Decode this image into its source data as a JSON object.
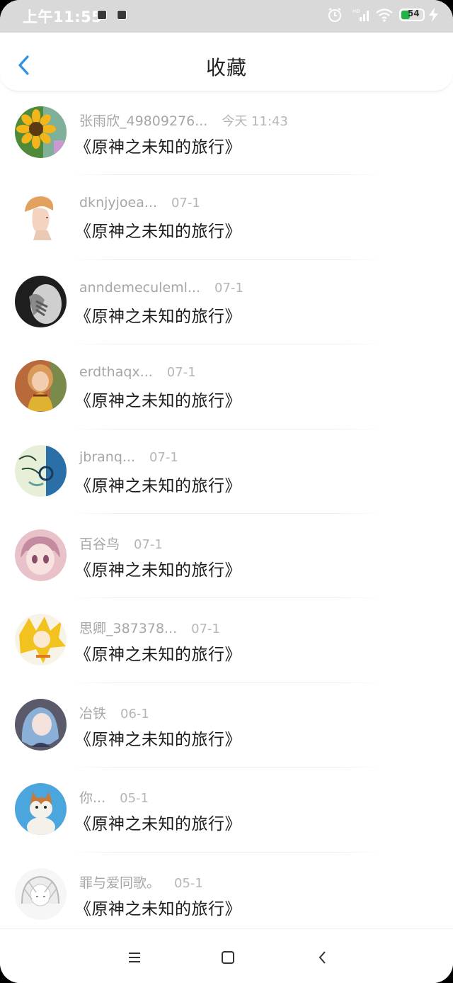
{
  "status_bar": {
    "time": "上午11:55",
    "battery_level": "54",
    "icons": [
      "alarm-icon",
      "signal-icon",
      "wifi-icon",
      "battery-icon",
      "charging-icon"
    ]
  },
  "header": {
    "title": "收藏",
    "back_icon": "chevron-left-icon"
  },
  "items": [
    {
      "name": "张雨欣_49809276...",
      "date": "今天 11:43",
      "title": "《原神之未知的旅行》",
      "avatar": "sunflower"
    },
    {
      "name": "dknjyjoea...",
      "date": "07-1",
      "title": "《原神之未知的旅行》",
      "avatar": "boy-profile"
    },
    {
      "name": "anndemeculeml...",
      "date": "07-1",
      "title": "《原神之未知的旅行》",
      "avatar": "bw-portrait"
    },
    {
      "name": "erdthaqx...",
      "date": "07-1",
      "title": "《原神之未知的旅行》",
      "avatar": "girl-photo"
    },
    {
      "name": "jbranq...",
      "date": "07-1",
      "title": "《原神之未知的旅行》",
      "avatar": "sketch-teal"
    },
    {
      "name": "百谷鸟",
      "date": "07-1",
      "title": "《原神之未知的旅行》",
      "avatar": "anime-pink"
    },
    {
      "name": "思卿_387378...",
      "date": "07-1",
      "title": "《原神之未知的旅行》",
      "avatar": "anime-yellow"
    },
    {
      "name": "冶铁",
      "date": "06-1",
      "title": "《原神之未知的旅行》",
      "avatar": "anime-blue"
    },
    {
      "name": "你...",
      "date": "05-1",
      "title": "《原神之未知的旅行》",
      "avatar": "cat"
    },
    {
      "name": "罪与爱同歌。",
      "date": "05-1",
      "title": "《原神之未知的旅行》",
      "avatar": "anime-sketch"
    }
  ],
  "nav_bar": {
    "buttons": [
      "menu-icon",
      "home-square-icon",
      "back-chevron-icon"
    ]
  },
  "colors": {
    "accent": "#2f8fe0",
    "name_text": "#a6a6a6",
    "title_text": "#1c1c1c",
    "status_bar_bg": "#d9d9d9"
  }
}
